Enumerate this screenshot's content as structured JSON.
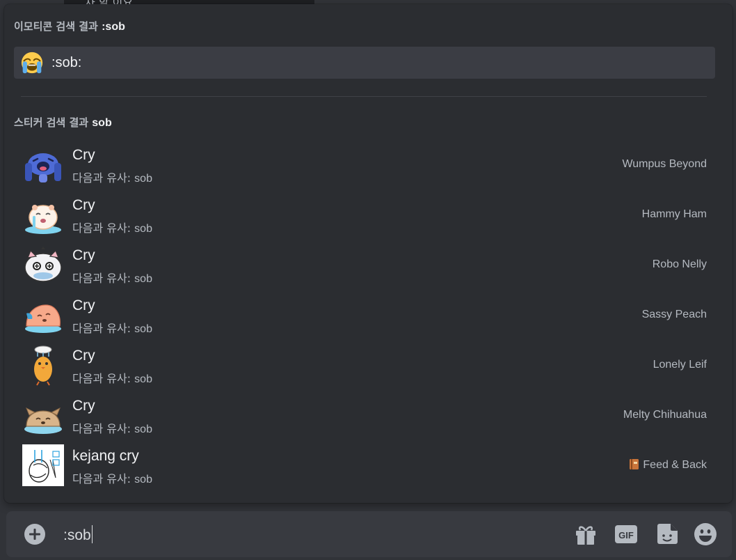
{
  "background_message": {
    "text": "차 할 이요"
  },
  "emoji_section": {
    "header_prefix": "이모티콘 검색 결과",
    "query": ":sob",
    "result": {
      "icon": "loudly-crying-face-emoji",
      "code": ":sob:"
    }
  },
  "sticker_section": {
    "header_prefix": "스티커 검색 결과",
    "query": "sob",
    "similar_label": "다음과 유사:",
    "items": [
      {
        "name": "Cry",
        "keyword": "sob",
        "pack": "Wumpus Beyond",
        "icon": "wumpus-crying-sticker"
      },
      {
        "name": "Cry",
        "keyword": "sob",
        "pack": "Hammy Ham",
        "icon": "hamster-crying-sticker"
      },
      {
        "name": "Cry",
        "keyword": "sob",
        "pack": "Robo Nelly",
        "icon": "robot-cat-crying-sticker"
      },
      {
        "name": "Cry",
        "keyword": "sob",
        "pack": "Sassy Peach",
        "icon": "peach-crying-sticker"
      },
      {
        "name": "Cry",
        "keyword": "sob",
        "pack": "Lonely Leif",
        "icon": "chick-crying-sticker"
      },
      {
        "name": "Cry",
        "keyword": "sob",
        "pack": "Melty Chihuahua",
        "icon": "chihuahua-crying-sticker"
      },
      {
        "name": "kejang cry",
        "keyword": "sob",
        "pack": "Feed & Back",
        "icon": "sketch-crying-sticker",
        "pack_icon": "book-icon"
      }
    ]
  },
  "composer": {
    "value": ":sob",
    "tools": [
      "plus-circle-icon",
      "gift-icon",
      "gif-icon",
      "sticker-icon",
      "emoji-icon"
    ],
    "gif_label": "GIF"
  },
  "colors": {
    "panel": "#2b2d31",
    "background": "#313338",
    "highlight_row": "#3b3d44",
    "composer": "#383a40",
    "text_primary": "#f2f3f5",
    "text_muted": "#b5bac1"
  }
}
